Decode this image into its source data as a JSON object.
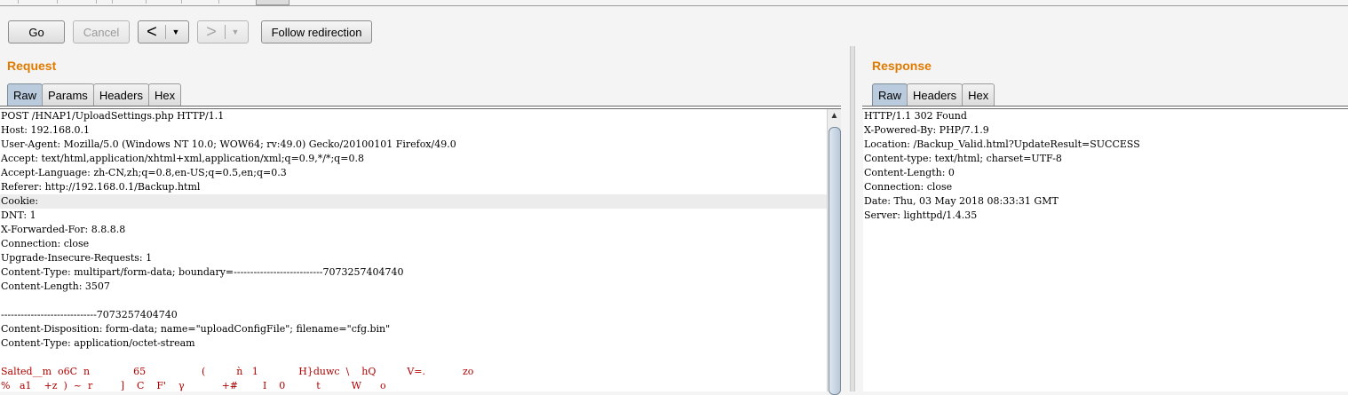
{
  "toolbar": {
    "go_label": "Go",
    "cancel_label": "Cancel",
    "back_arrow": "<",
    "forward_arrow": ">",
    "dropdown_glyph": "▼",
    "follow_label": "Follow redirection"
  },
  "request": {
    "title": "Request",
    "tabs": [
      "Raw",
      "Params",
      "Headers",
      "Hex"
    ],
    "active_tab": "Raw",
    "lines": [
      "POST /HNAP1/UploadSettings.php HTTP/1.1",
      "Host: 192.168.0.1",
      "User-Agent: Mozilla/5.0 (Windows NT 10.0; WOW64; rv:49.0) Gecko/20100101 Firefox/49.0",
      "Accept: text/html,application/xhtml+xml,application/xml;q=0.9,*/*;q=0.8",
      "Accept-Language: zh-CN,zh;q=0.8,en-US;q=0.5,en;q=0.3",
      "Referer: http://192.168.0.1/Backup.html",
      "Cookie:",
      "DNT: 1",
      "X-Forwarded-For: 8.8.8.8",
      "Connection: close",
      "Upgrade-Insecure-Requests: 1",
      "Content-Type: multipart/form-data; boundary=---------------------------7073257404740",
      "Content-Length: 3507",
      "",
      "-----------------------------7073257404740",
      "Content-Disposition: form-data; name=\"uploadConfigFile\"; filename=\"cfg.bin\"",
      "Content-Type: application/octet-stream",
      "",
      "Salted__m  o6C  n              65                  (          ǹ   1             H}duwc  \\    hQ          V=.            zo",
      "%   a1    +z  )  ~  r         ]    C    F'    γ            +#        I    0          t          W      o"
    ]
  },
  "response": {
    "title": "Response",
    "tabs": [
      "Raw",
      "Headers",
      "Hex"
    ],
    "active_tab": "Raw",
    "lines": [
      "HTTP/1.1 302 Found",
      "X-Powered-By: PHP/7.1.9",
      "Location: /Backup_Valid.html?UpdateResult=SUCCESS",
      "Content-type: text/html; charset=UTF-8",
      "Content-Length: 0",
      "Connection: close",
      "Date: Thu, 03 May 2018 08:33:31 GMT",
      "Server: lighttpd/1.4.35"
    ]
  }
}
